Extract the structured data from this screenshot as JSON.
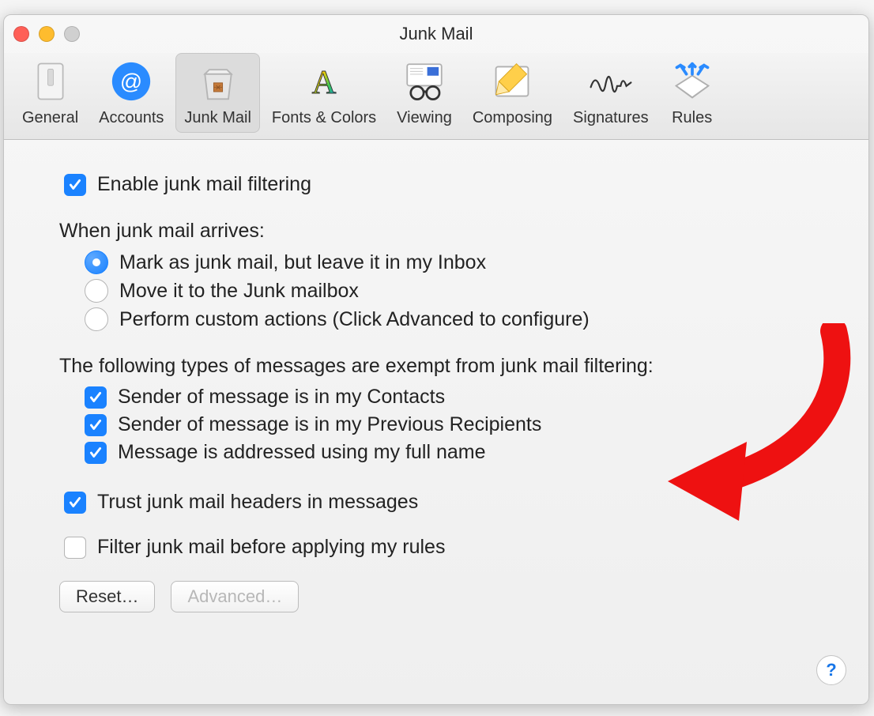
{
  "window": {
    "title": "Junk Mail"
  },
  "toolbar": {
    "items": [
      {
        "label": "General"
      },
      {
        "label": "Accounts"
      },
      {
        "label": "Junk Mail"
      },
      {
        "label": "Fonts & Colors"
      },
      {
        "label": "Viewing"
      },
      {
        "label": "Composing"
      },
      {
        "label": "Signatures"
      },
      {
        "label": "Rules"
      }
    ]
  },
  "prefs": {
    "enable_label": "Enable junk mail filtering",
    "arrives_title": "When junk mail arrives:",
    "arrives_options": [
      "Mark as junk mail, but leave it in my Inbox",
      "Move it to the Junk mailbox",
      "Perform custom actions (Click Advanced to configure)"
    ],
    "exempt_title": "The following types of messages are exempt from junk mail filtering:",
    "exempt_options": [
      "Sender of message is in my Contacts",
      "Sender of message is in my Previous Recipients",
      "Message is addressed using my full name"
    ],
    "trust_label": "Trust junk mail headers in messages",
    "filter_before_label": "Filter junk mail before applying my rules"
  },
  "buttons": {
    "reset": "Reset…",
    "advanced": "Advanced…",
    "help": "?"
  }
}
